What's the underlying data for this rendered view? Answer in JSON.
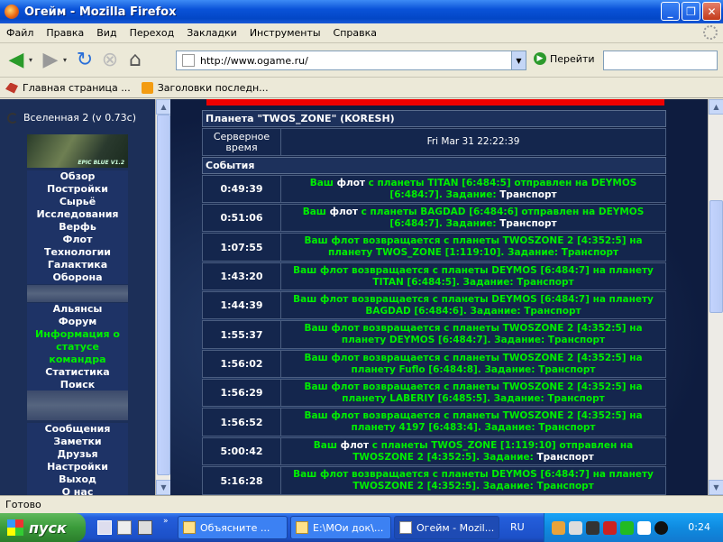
{
  "window": {
    "title": "Огейм - Mozilla Firefox"
  },
  "menu": [
    "Файл",
    "Правка",
    "Вид",
    "Переход",
    "Закладки",
    "Инструменты",
    "Справка"
  ],
  "nav": {
    "url": "http://www.ogame.ru/",
    "go_label": "Перейти"
  },
  "bookmarks": [
    "Главная страница ...",
    "Заголовки последн..."
  ],
  "sidebar": {
    "universe": "Вселенная 2 (v 0.73c)",
    "banner_text": "EPIC BLUE V1.2",
    "group1": [
      "Обзор",
      "Постройки",
      "Сырьё",
      "Исследования",
      "Верфь",
      "Флот",
      "Технологии",
      "Галактика",
      "Оборона"
    ],
    "group2": [
      "Альянсы",
      "Форум",
      "Информация о статусе",
      "командра",
      "Статистика",
      "Поиск"
    ],
    "group3": [
      "Сообщения",
      "Заметки",
      "Друзья",
      "Настройки",
      "Выход",
      "О нас"
    ]
  },
  "main": {
    "planet_header": "Планета \"TWOS_ZONE\" (KORESH)",
    "server_time_label": "Серверное время",
    "server_time": "Fri Mar 31 22:22:39",
    "events_header": "События",
    "events": [
      {
        "time": "0:49:39",
        "a": "Ваш ",
        "b": "флот",
        "c": " с планеты TITAN [6:484:5] отправлен на DEYMOS [6:484:7]. Задание: ",
        "d": "Транспорт"
      },
      {
        "time": "0:51:06",
        "a": "Ваш ",
        "b": "флот",
        "c": " с планеты BAGDAD [6:484:6] отправлен на DEYMOS [6:484:7]. Задание: ",
        "d": "Транспорт"
      },
      {
        "time": "1:07:55",
        "a": "Ваш флот возвращается с планеты TWOSZONE 2 [4:352:5] на планету TWOS_ZONE [1:119:10]. Задание: Транспорт",
        "b": "",
        "c": "",
        "d": ""
      },
      {
        "time": "1:43:20",
        "a": "Ваш флот возвращается с планеты DEYMOS [6:484:7] на планету TITAN [6:484:5]. Задание: Транспорт",
        "b": "",
        "c": "",
        "d": ""
      },
      {
        "time": "1:44:39",
        "a": "Ваш флот возвращается с планеты DEYMOS [6:484:7] на планету BAGDAD [6:484:6]. Задание: Транспорт",
        "b": "",
        "c": "",
        "d": ""
      },
      {
        "time": "1:55:37",
        "a": "Ваш флот возвращается с планеты TWOSZONE 2 [4:352:5] на планету DEYMOS [6:484:7]. Задание: Транспорт",
        "b": "",
        "c": "",
        "d": ""
      },
      {
        "time": "1:56:02",
        "a": "Ваш флот возвращается с планеты TWOSZONE 2 [4:352:5] на планету Fuflo [6:484:8]. Задание: Транспорт",
        "b": "",
        "c": "",
        "d": ""
      },
      {
        "time": "1:56:29",
        "a": "Ваш флот возвращается с планеты TWOSZONE 2 [4:352:5] на планету LABERIY [6:485:5]. Задание: Транспорт",
        "b": "",
        "c": "",
        "d": ""
      },
      {
        "time": "1:56:52",
        "a": "Ваш флот возвращается с планеты TWOSZONE 2 [4:352:5] на планету 4197 [6:483:4]. Задание: Транспорт",
        "b": "",
        "c": "",
        "d": ""
      },
      {
        "time": "5:00:42",
        "a": "Ваш ",
        "b": "флот",
        "c": " с планеты TWOS_ZONE [1:119:10] отправлен на TWOSZONE 2 [4:352:5]. Задание: ",
        "d": "Транспорт"
      },
      {
        "time": "5:16:28",
        "a": "Ваш флот возвращается с планеты DEYMOS [6:484:7] на планету TWOSZONE 2 [4:352:5]. Задание: Транспорт",
        "b": "",
        "c": "",
        "d": ""
      }
    ]
  },
  "status": "Готово",
  "taskbar": {
    "start": "пуск",
    "tasks": [
      "Объясните ...",
      "E:\\МОи док\\...",
      "Огейм - Mozil..."
    ],
    "lang": "RU",
    "clock": "0:24"
  }
}
